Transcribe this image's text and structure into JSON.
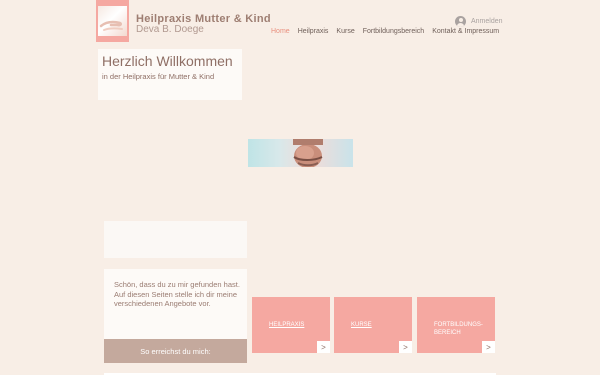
{
  "header": {
    "title": "Heilpraxis Mutter & Kind",
    "subtitle": "Deva B. Doege",
    "login_label": "Anmelden"
  },
  "nav": {
    "items": [
      {
        "label": "Home",
        "active": true
      },
      {
        "label": "Heilpraxis",
        "active": false
      },
      {
        "label": "Kurse",
        "active": false
      },
      {
        "label": "Fortbildungsbereich",
        "active": false
      },
      {
        "label": "Kontakt & Impressum",
        "active": false
      }
    ]
  },
  "welcome": {
    "title": "Herzlich Willkommen",
    "subtitle": "in der Heilpraxis für Mutter & Kind"
  },
  "intro": {
    "text": "Schön, dass du zu mir gefunden hast.\nAuf diesen Seiten stelle ich dir meine verschiedenen Angebote vor.",
    "contact_button": "So erreichst du mich:"
  },
  "cards": [
    {
      "label": "HEILPRAXIS",
      "arrow": ">"
    },
    {
      "label": "KURSE",
      "arrow": ">"
    },
    {
      "label": "FORTBILDUNGS-\nBEREICH",
      "arrow": ">"
    }
  ],
  "colors": {
    "background": "#f8eee6",
    "accent": "#f5a8a1",
    "button": "#c4a99d",
    "nav_active": "#e9907f"
  }
}
